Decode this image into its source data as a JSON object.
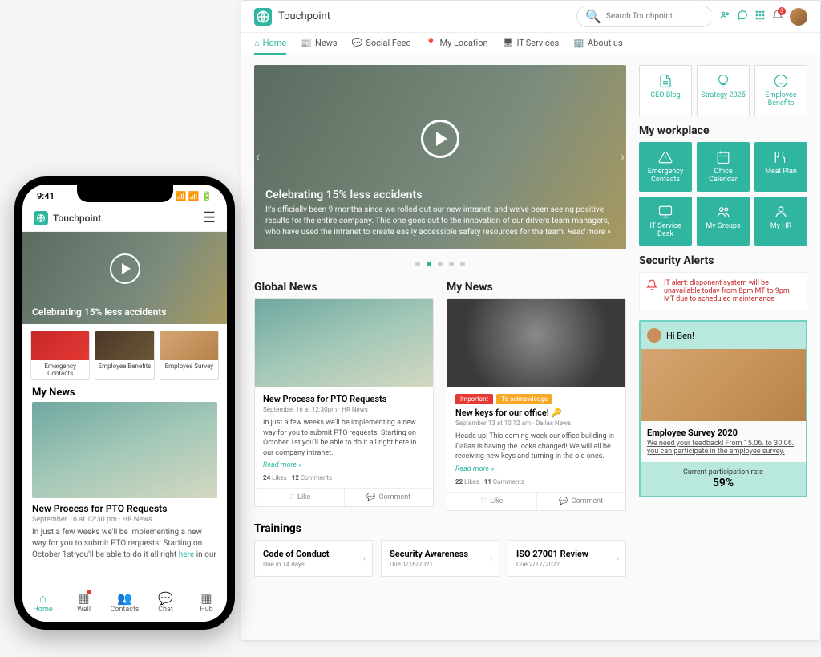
{
  "brand": "Touchpoint",
  "search_placeholder": "Search Touchpoint...",
  "notification_count": "3",
  "nav": [
    "Home",
    "News",
    "Social Feed",
    "My Location",
    "IT-Services",
    "About us"
  ],
  "hero": {
    "title": "Celebrating 15% less accidents",
    "body": "It's officially been 9 months since we rolled out our new intranet, and we've been seeing positive results for the entire company. This one goes out to the innovation of our drivers team managers, who have used the intranet to create easily accessible safety resources for the team.",
    "read_more": "Read more »"
  },
  "quicklinks": [
    {
      "label": "CEO Blog",
      "icon": "document-icon"
    },
    {
      "label": "Strategy 2025",
      "icon": "lightbulb-icon"
    },
    {
      "label": "Employee Benefits",
      "icon": "smile-icon"
    }
  ],
  "workplace_title": "My workplace",
  "workplace": [
    {
      "label": "Emergency Contacts",
      "icon": "alert-icon"
    },
    {
      "label": "Office Calendar",
      "icon": "calendar-icon"
    },
    {
      "label": "Meal Plan",
      "icon": "meal-icon"
    },
    {
      "label": "IT Service Desk",
      "icon": "monitor-icon"
    },
    {
      "label": "My Groups",
      "icon": "groups-icon"
    },
    {
      "label": "My HR",
      "icon": "person-icon"
    }
  ],
  "alerts_title": "Security Alerts",
  "alert_text": "IT alert: disponent system will be unavailable today from 8pm MT to 9pm MT due to scheduled maintenance",
  "survey": {
    "greeting": "Hi Ben!",
    "title": "Employee Survey 2020",
    "desc": "We need your feedback! From 15.06. to 30.06. you can participate in the employee survey.",
    "rate_label": "Current participation rate",
    "rate": "59%"
  },
  "global_news_title": "Global News",
  "my_news_title": "My News",
  "news1": {
    "title": "New Process for PTO Requests",
    "meta": "September 16 at 12:30pm · HR News",
    "text": "In just a few weeks we'll be implementing a new way for you to submit PTO requests! Starting on October 1st you'll be able to do it all right here in our company intranet.",
    "likes": "24",
    "comments": "12"
  },
  "news2": {
    "tag_important": "Important",
    "tag_ack": "To acknowledge",
    "title": "New keys for our office! 🔑",
    "meta": "September 13 at 10:12 am · Dallas News",
    "text": "Heads up: This coming week our office building in Dallas is having the locks changed! We will all be receiving new keys and turning in the old ones.",
    "likes": "22",
    "comments": "11"
  },
  "read_more_label": "Read more »",
  "likes_label": "Likes",
  "comments_label": "Comments",
  "like_action": "Like",
  "comment_action": "Comment",
  "trainings_title": "Trainings",
  "trainings": [
    {
      "title": "Code of Conduct",
      "due": "Due in 14 days"
    },
    {
      "title": "Security Awareness",
      "due": "Due 1/16/2021"
    },
    {
      "title": "ISO 27001 Review",
      "due": "Due 2/17/2022"
    }
  ],
  "phone": {
    "time": "9:41",
    "hero_title": "Celebrating 15% less accidents",
    "tiles": [
      "Emergency Contacts",
      "Employee Benefits",
      "Employee Survey"
    ],
    "my_news": "My News",
    "news_title": "New Process for PTO Requests",
    "news_meta": "September 16 at 12:30 pm · HR News",
    "news_text_a": "In just a few weeks we'll be implementing a new way for you to submit PTO requests! Starting on October 1st you'll be able to do it all right ",
    "news_text_here": "here",
    "news_text_b": " in our",
    "tabs": [
      "Home",
      "Wall",
      "Contacts",
      "Chat",
      "Hub"
    ]
  }
}
